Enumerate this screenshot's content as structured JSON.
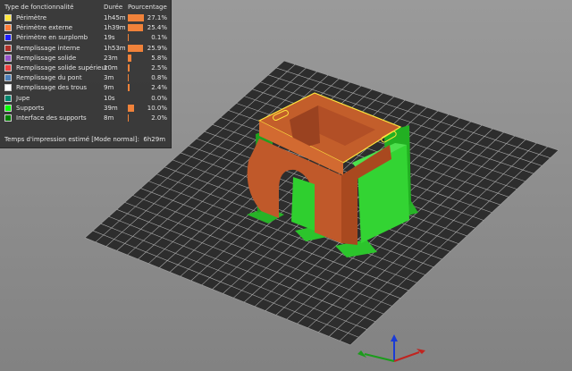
{
  "legend": {
    "col_type": "Type de fonctionnalité",
    "col_duration": "Durée",
    "col_percent": "Pourcentage",
    "rows": [
      {
        "name": "Périmètre",
        "duration": "1h45m",
        "percent": "27.1%",
        "fraction": 0.271,
        "color": "#ffe63d"
      },
      {
        "name": "Périmètre externe",
        "duration": "1h39m",
        "percent": "25.4%",
        "fraction": 0.254,
        "color": "#ff7d38"
      },
      {
        "name": "Périmètre en surplomb",
        "duration": "19s",
        "percent": "0.1%",
        "fraction": 0.001,
        "color": "#1f1fff"
      },
      {
        "name": "Remplissage interne",
        "duration": "1h53m",
        "percent": "25.9%",
        "fraction": 0.259,
        "color": "#b03029"
      },
      {
        "name": "Remplissage solide",
        "duration": "23m",
        "percent": "5.8%",
        "fraction": 0.058,
        "color": "#9654cc"
      },
      {
        "name": "Remplissage solide supérieur",
        "duration": "10m",
        "percent": "2.5%",
        "fraction": 0.025,
        "color": "#f04040"
      },
      {
        "name": "Remplissage du pont",
        "duration": "3m",
        "percent": "0.8%",
        "fraction": 0.008,
        "color": "#4d80ba"
      },
      {
        "name": "Remplissage des trous",
        "duration": "9m",
        "percent": "2.4%",
        "fraction": 0.024,
        "color": "#ffffff"
      },
      {
        "name": "Jupe",
        "duration": "10s",
        "percent": "0.0%",
        "fraction": 0.0,
        "color": "#00876e"
      },
      {
        "name": "Supports",
        "duration": "39m",
        "percent": "10.0%",
        "fraction": 0.1,
        "color": "#00ff00"
      },
      {
        "name": "Interface des supports",
        "duration": "8m",
        "percent": "2.0%",
        "fraction": 0.02,
        "color": "#008000"
      }
    ],
    "estimate_label": "Temps d'impression estimé [Mode normal]:",
    "estimate_value": "6h29m"
  },
  "colors": {
    "background": "#8d8d8d",
    "bed": "#2d2d2d",
    "grid": "#aaaaaa",
    "part_orange": "#c8622c",
    "support_green": "#2fcf2f",
    "perimeter_yellow": "#ffe63d"
  }
}
